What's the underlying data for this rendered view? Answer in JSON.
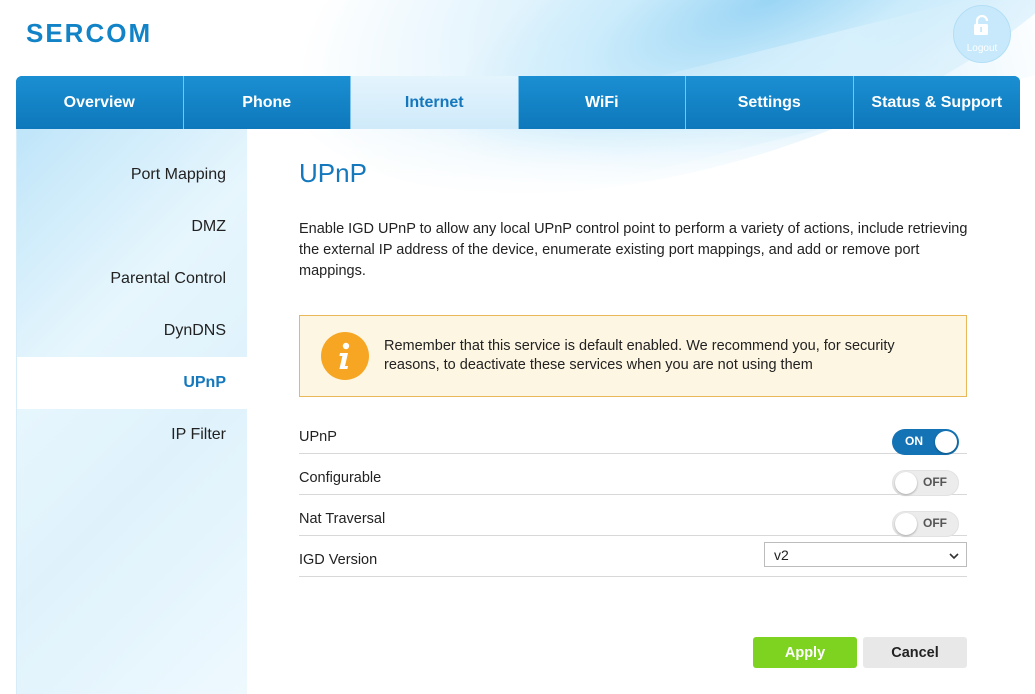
{
  "brand": {
    "name": "SERCOM",
    "color": "#1283c6"
  },
  "header": {
    "logout_label": "Logout",
    "logout_icon": "unlock-icon"
  },
  "tabs": [
    {
      "label": "Overview",
      "active": false
    },
    {
      "label": "Phone",
      "active": false
    },
    {
      "label": "Internet",
      "active": true
    },
    {
      "label": "WiFi",
      "active": false
    },
    {
      "label": "Settings",
      "active": false
    },
    {
      "label": "Status & Support",
      "active": false
    }
  ],
  "sidebar": {
    "items": [
      {
        "label": "Port Mapping",
        "active": false
      },
      {
        "label": "DMZ",
        "active": false
      },
      {
        "label": "Parental Control",
        "active": false
      },
      {
        "label": "DynDNS",
        "active": false
      },
      {
        "label": "UPnP",
        "active": true
      },
      {
        "label": "IP Filter",
        "active": false
      }
    ]
  },
  "main": {
    "title": "UPnP",
    "description": "Enable IGD UPnP to allow any local UPnP control point to perform a variety of actions, include retrieving the external IP address of the device, enumerate existing port mappings, and add or remove port mappings.",
    "notice": {
      "icon": "info-icon",
      "text": "Remember that this service is default enabled. We recommend you, for security reasons, to deactivate these services when you are not using them",
      "background": "#fdf6e2",
      "border": "#e9b85a"
    },
    "settings": [
      {
        "label": "UPnP",
        "type": "toggle",
        "value": "ON"
      },
      {
        "label": "Configurable",
        "type": "toggle",
        "value": "OFF"
      },
      {
        "label": "Nat Traversal",
        "type": "toggle",
        "value": "OFF"
      },
      {
        "label": "IGD Version",
        "type": "select",
        "value": "v2"
      }
    ],
    "apply_label": "Apply",
    "cancel_label": "Cancel"
  },
  "colors": {
    "accent": "#1578bd",
    "apply": "#7ed321",
    "toggle_on": "#1473b5",
    "warning": "#f6a623"
  }
}
